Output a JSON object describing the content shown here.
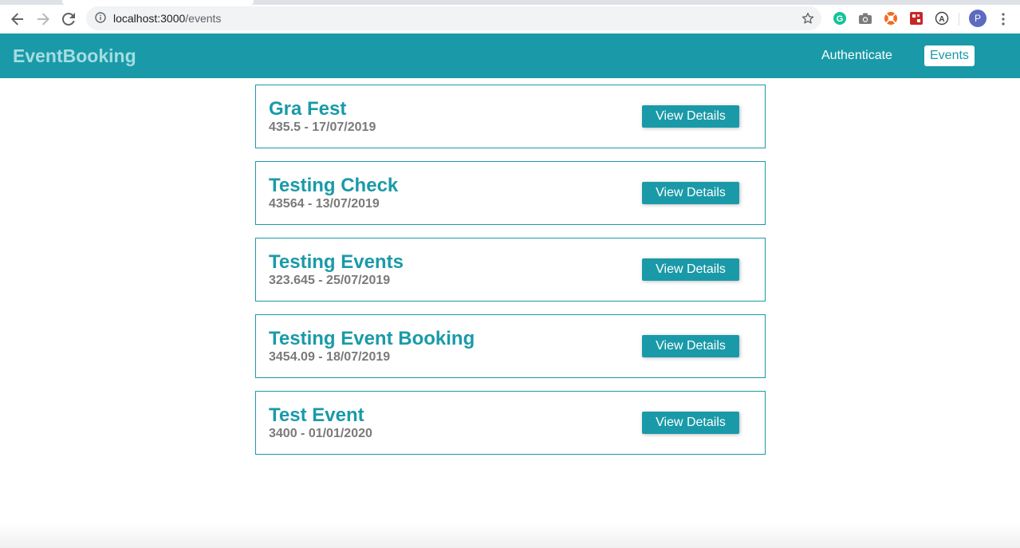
{
  "browser": {
    "url_host": "localhost:3000",
    "url_path": "/events",
    "profile_initial": "P"
  },
  "nav": {
    "brand": "EventBooking",
    "links": [
      {
        "label": "Authenticate",
        "active": false
      },
      {
        "label": "Events",
        "active": true
      }
    ]
  },
  "events": [
    {
      "title": "Gra Fest",
      "subtitle": "435.5 - 17/07/2019",
      "button": "View Details"
    },
    {
      "title": "Testing Check",
      "subtitle": "43564 - 13/07/2019",
      "button": "View Details"
    },
    {
      "title": "Testing Events",
      "subtitle": "323.645 - 25/07/2019",
      "button": "View Details"
    },
    {
      "title": "Testing Event Booking",
      "subtitle": "3454.09 - 18/07/2019",
      "button": "View Details"
    },
    {
      "title": "Test Event",
      "subtitle": "3400 - 01/01/2020",
      "button": "View Details"
    }
  ],
  "colors": {
    "accent": "#1a9aa8",
    "brand_text": "#a4dde2",
    "subtitle": "#7a7a7a"
  },
  "icons": [
    "back-arrow-icon",
    "forward-arrow-icon",
    "reload-icon",
    "info-icon",
    "star-icon",
    "grammarly-icon",
    "camera-icon",
    "extension-orange-icon",
    "extension-red-icon",
    "extension-a-icon",
    "more-vert-icon"
  ]
}
